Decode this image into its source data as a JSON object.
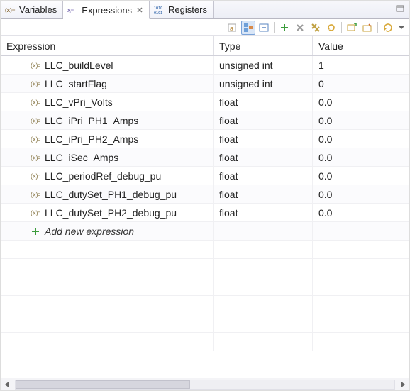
{
  "tabs": {
    "variables": {
      "label": "Variables"
    },
    "expressions": {
      "label": "Expressions"
    },
    "registers": {
      "label": "Registers"
    }
  },
  "columns": {
    "expr": "Expression",
    "type": "Type",
    "value": "Value"
  },
  "rows": [
    {
      "name": "LLC_buildLevel",
      "type": "unsigned int",
      "value": "1"
    },
    {
      "name": "LLC_startFlag",
      "type": "unsigned int",
      "value": "0"
    },
    {
      "name": "LLC_vPri_Volts",
      "type": "float",
      "value": "0.0"
    },
    {
      "name": "LLC_iPri_PH1_Amps",
      "type": "float",
      "value": "0.0"
    },
    {
      "name": "LLC_iPri_PH2_Amps",
      "type": "float",
      "value": "0.0"
    },
    {
      "name": "LLC_iSec_Amps",
      "type": "float",
      "value": "0.0"
    },
    {
      "name": "LLC_periodRef_debug_pu",
      "type": "float",
      "value": "0.0"
    },
    {
      "name": "LLC_dutySet_PH1_debug_pu",
      "type": "float",
      "value": "0.0"
    },
    {
      "name": "LLC_dutySet_PH2_debug_pu",
      "type": "float",
      "value": "0.0"
    }
  ],
  "addNew": "Add new expression",
  "icons": {
    "variables": "(x)=",
    "expressions": "expr",
    "registers": "1010"
  },
  "toolbar": {
    "showTypeNames": "show-type-names",
    "collapseAll": "collapse-all",
    "continuousRefresh": "continuous-refresh",
    "add": "add",
    "removeSelected": "remove-selected",
    "removeAll": "remove-all",
    "refresh": "refresh",
    "newWatch": "new-watch",
    "openSnapshot": "open-snapshot",
    "saveSnapshot": "save-snapshot",
    "menu": "view-menu"
  },
  "colors": {
    "accent": "#3b6fb6"
  }
}
